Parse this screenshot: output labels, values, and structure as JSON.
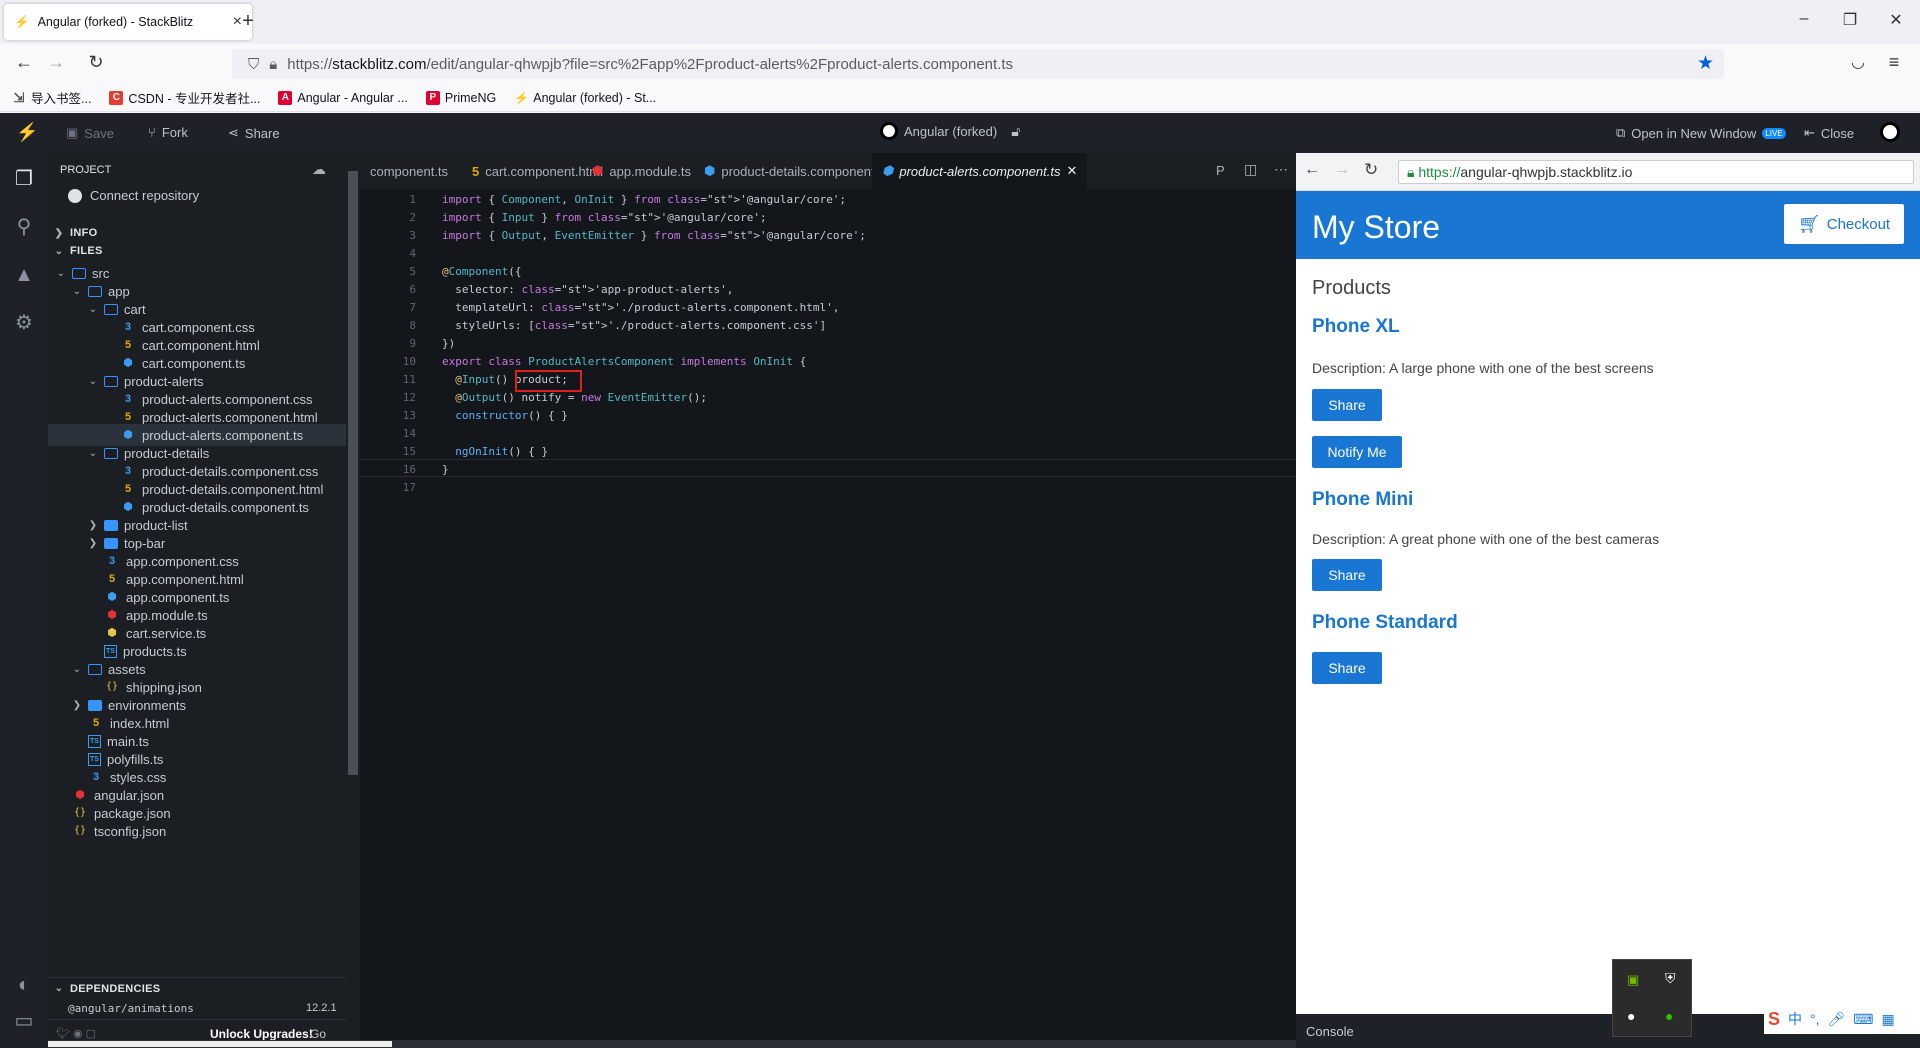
{
  "browser": {
    "tab_title": "Angular (forked) - StackBlitz",
    "url_prefix": "https://",
    "url_host": "stackblitz.com",
    "url_path": "/edit/angular-qhwpjb?file=src%2Fapp%2Fproduct-alerts%2Fproduct-alerts.component.ts",
    "bookmarks": [
      {
        "label": "导入书签...",
        "color": "#555"
      },
      {
        "label": "CSDN - 专业开发者社...",
        "color": "#e63b2e"
      },
      {
        "label": "Angular - Angular ...",
        "color": "#dd0031"
      },
      {
        "label": "PrimeNG",
        "color": "#dd0031"
      },
      {
        "label": "Angular (forked) - St...",
        "color": "#1389fd"
      }
    ]
  },
  "stackblitz": {
    "save_label": "Save",
    "fork_label": "Fork",
    "share_label": "Share",
    "project_title": "Angular (forked)",
    "open_new_window_label": "Open in New Window",
    "live_badge": "LIVE",
    "close_label": "Close"
  },
  "sidebar": {
    "project_label": "PROJECT",
    "connect_repo_label": "Connect repository",
    "info_label": "INFO",
    "files_label": "FILES",
    "dependencies_label": "DEPENDENCIES",
    "dep_first": "@angular/animations",
    "dep_first_version": "12.2.1",
    "unlock_label": "Unlock Upgrades!",
    "go_label": "Go",
    "tree": [
      {
        "label": "src",
        "kind": "folder",
        "depth": 0,
        "open": true
      },
      {
        "label": "app",
        "kind": "folder",
        "depth": 1,
        "open": true
      },
      {
        "label": "cart",
        "kind": "folder",
        "depth": 2,
        "open": true
      },
      {
        "label": "cart.component.css",
        "kind": "css",
        "depth": 3
      },
      {
        "label": "cart.component.html",
        "kind": "html",
        "depth": 3
      },
      {
        "label": "cart.component.ts",
        "kind": "ts",
        "depth": 3
      },
      {
        "label": "product-alerts",
        "kind": "folder",
        "depth": 2,
        "open": true
      },
      {
        "label": "product-alerts.component.css",
        "kind": "css",
        "depth": 3
      },
      {
        "label": "product-alerts.component.html",
        "kind": "html",
        "depth": 3
      },
      {
        "label": "product-alerts.component.ts",
        "kind": "ts",
        "depth": 3,
        "selected": true
      },
      {
        "label": "product-details",
        "kind": "folder",
        "depth": 2,
        "open": true
      },
      {
        "label": "product-details.component.css",
        "kind": "css",
        "depth": 3
      },
      {
        "label": "product-details.component.html",
        "kind": "html",
        "depth": 3
      },
      {
        "label": "product-details.component.ts",
        "kind": "ts",
        "depth": 3
      },
      {
        "label": "product-list",
        "kind": "folder-closed",
        "depth": 2
      },
      {
        "label": "top-bar",
        "kind": "folder-closed",
        "depth": 2
      },
      {
        "label": "app.component.css",
        "kind": "css",
        "depth": 2
      },
      {
        "label": "app.component.html",
        "kind": "html",
        "depth": 2
      },
      {
        "label": "app.component.ts",
        "kind": "ts",
        "depth": 2
      },
      {
        "label": "app.module.ts",
        "kind": "ang",
        "depth": 2
      },
      {
        "label": "cart.service.ts",
        "kind": "ang-y",
        "depth": 2
      },
      {
        "label": "products.ts",
        "kind": "tsf",
        "depth": 2
      },
      {
        "label": "assets",
        "kind": "folder",
        "depth": 1,
        "open": true
      },
      {
        "label": "shipping.json",
        "kind": "json",
        "depth": 2
      },
      {
        "label": "environments",
        "kind": "folder-closed",
        "depth": 1
      },
      {
        "label": "index.html",
        "kind": "html",
        "depth": 1
      },
      {
        "label": "main.ts",
        "kind": "tsf",
        "depth": 1
      },
      {
        "label": "polyfills.ts",
        "kind": "tsf",
        "depth": 1
      },
      {
        "label": "styles.css",
        "kind": "css",
        "depth": 1
      },
      {
        "label": "angular.json",
        "kind": "ang",
        "depth": 0
      },
      {
        "label": "package.json",
        "kind": "json",
        "depth": 0
      },
      {
        "label": "tsconfig.json",
        "kind": "json",
        "depth": 0
      }
    ]
  },
  "editor": {
    "tabs": [
      {
        "label": "component.ts",
        "kind": "none"
      },
      {
        "label": "cart.component.html",
        "kind": "html"
      },
      {
        "label": "app.module.ts",
        "kind": "ang"
      },
      {
        "label": "product-details.component.ts",
        "kind": "ts"
      },
      {
        "label": "product-alerts.component.ts",
        "kind": "ts",
        "active": true
      }
    ],
    "lines": [
      "import { Component, OnInit } from '@angular/core';",
      "import { Input } from '@angular/core';",
      "import { Output, EventEmitter } from '@angular/core';",
      "",
      "@Component({",
      "  selector: 'app-product-alerts',",
      "  templateUrl: './product-alerts.component.html',",
      "  styleUrls: ['./product-alerts.component.css']",
      "})",
      "export class ProductAlertsComponent implements OnInit {",
      "  @Input() product;",
      "  @Output() notify = new EventEmitter();",
      "  constructor() { }",
      "",
      "  ngOnInit() { }",
      "}",
      ""
    ]
  },
  "preview": {
    "url_scheme": "https://",
    "url_host": "angular-qhwpjb.stackblitz.io",
    "store_title": "My Store",
    "checkout_label": "Checkout",
    "products_heading": "Products",
    "phone_xl": "Phone XL",
    "phone_xl_desc": "Description: A large phone with one of the best screens",
    "phone_mini": "Phone Mini",
    "phone_mini_desc": "Description: A great phone with one of the best cameras",
    "phone_standard": "Phone Standard",
    "share_label": "Share",
    "notify_label": "Notify Me",
    "console_label": "Console"
  }
}
